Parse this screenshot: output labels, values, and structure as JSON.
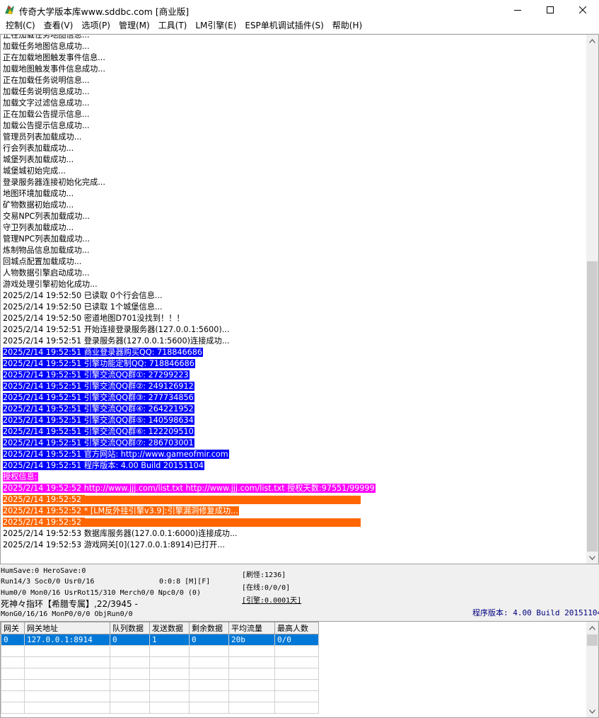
{
  "window": {
    "title": "传奇大学版本库www.sddbc.com [商业版]",
    "icon": "app-logo-icon",
    "controls": [
      "minimize-icon",
      "maximize-icon",
      "close-icon"
    ]
  },
  "menu": [
    "控制(C)",
    "查看(V)",
    "选项(P)",
    "管理(M)",
    "工具(T)",
    "LM引擎(E)",
    "ESP单机调试插件(S)",
    "帮助(H)"
  ],
  "log": {
    "lines": [
      {
        "text": "正在加载任务地图信息...",
        "style": "normal"
      },
      {
        "text": "加载任务地图信息成功...",
        "style": "normal"
      },
      {
        "text": "正在加载地图触发事件信息...",
        "style": "normal"
      },
      {
        "text": "加载地图触发事件信息成功...",
        "style": "normal"
      },
      {
        "text": "正在加载任务说明信息...",
        "style": "normal"
      },
      {
        "text": "加载任务说明信息成功...",
        "style": "normal"
      },
      {
        "text": "加载文字过滤信息成功...",
        "style": "normal"
      },
      {
        "text": "正在加载公告提示信息...",
        "style": "normal"
      },
      {
        "text": "加载公告提示信息成功...",
        "style": "normal"
      },
      {
        "text": "管理员列表加载成功...",
        "style": "normal"
      },
      {
        "text": "行会列表加载成功...",
        "style": "normal"
      },
      {
        "text": "城堡列表加载成功...",
        "style": "normal"
      },
      {
        "text": "城堡城初始完成...",
        "style": "normal"
      },
      {
        "text": "登录服务器连接初始化完成...",
        "style": "normal"
      },
      {
        "text": "地图环境加载成功...",
        "style": "normal"
      },
      {
        "text": "矿物数据初始成功...",
        "style": "normal"
      },
      {
        "text": "交易NPC列表加载成功...",
        "style": "normal"
      },
      {
        "text": "守卫列表加载成功...",
        "style": "normal"
      },
      {
        "text": "管理NPC列表加载成功...",
        "style": "normal"
      },
      {
        "text": "炼制物品信息加载成功...",
        "style": "normal"
      },
      {
        "text": "回城点配置加载成功...",
        "style": "normal"
      },
      {
        "text": "人物数据引擎启动成功...",
        "style": "normal"
      },
      {
        "text": "游戏处理引擎初始化成功...",
        "style": "normal"
      },
      {
        "text": "2025/2/14 19:52:50 已读取 0个行会信息...",
        "style": "normal"
      },
      {
        "text": "2025/2/14 19:52:50 已读取 1个城堡信息...",
        "style": "normal"
      },
      {
        "text": "2025/2/14 19:52:50 密道地图D701没找到！！！",
        "style": "normal"
      },
      {
        "text": "2025/2/14 19:52:51 开始连接登录服务器(127.0.0.1:5600)...",
        "style": "normal"
      },
      {
        "text": "2025/2/14 19:52:51 登录服务器(127.0.0.1:5600)连接成功...",
        "style": "normal"
      },
      {
        "text": "2025/2/14 19:52:51 商业登录器购买QQ: 718846686",
        "style": "blue"
      },
      {
        "text": "2025/2/14 19:52:51 引擎功能定制QQ: 718846686",
        "style": "blue"
      },
      {
        "text": "2025/2/14 19:52:51 引擎交流QQ群①: 27299223",
        "style": "blue"
      },
      {
        "text": "2025/2/14 19:52:51 引擎交流QQ群②: 249126912",
        "style": "blue"
      },
      {
        "text": "2025/2/14 19:52:51 引擎交流QQ群③: 277734856",
        "style": "blue"
      },
      {
        "text": "2025/2/14 19:52:51 引擎交流QQ群④: 264221952",
        "style": "blue"
      },
      {
        "text": "2025/2/14 19:52:51 引擎交流QQ群⑤: 140598634",
        "style": "blue"
      },
      {
        "text": "2025/2/14 19:52:51 引擎交流QQ群⑥: 122209510",
        "style": "blue"
      },
      {
        "text": "2025/2/14 19:52:51 引擎交流QQ群⑦: 286703001",
        "style": "blue"
      },
      {
        "text": "2025/2/14 19:52:51 官方网站: http://www.gameofmir.com",
        "style": "blue"
      },
      {
        "text": "2025/2/14 19:52:51 程序版本: 4.00 Build 20151104",
        "style": "blue"
      },
      {
        "text": "授权信息:",
        "style": "magenta"
      },
      {
        "text": "2025/2/14 19:52:52 http://www.jjj.com/list.txt http://www.jjj.com/list.txt 授权天数:97551/99999",
        "style": "magenta"
      },
      {
        "text": "2025/2/14 19:52:52 ",
        "style": "orange-bar"
      },
      {
        "text": "2025/2/14 19:52:52 * [LM反外挂引擎v3.9]:引擎漏洞修复成功...",
        "style": "orange"
      },
      {
        "text": "2025/2/14 19:52:52 ",
        "style": "orange-bar"
      },
      {
        "text": "2025/2/14 19:52:53 数据库服务器(127.0.0.1:6000)连接成功...",
        "style": "normal"
      },
      {
        "text": "2025/2/14 19:52:53 游戏网关[0](127.0.0.1:8914)已打开...",
        "style": "normal"
      }
    ],
    "scroll_position": 0.42
  },
  "status": {
    "line1": "HumSave:0 HeroSave:0",
    "line2a": "Run14/3 Soc0/0 Usr0/16",
    "line2b": "0:0:8 [M][F]",
    "line3": "Hum0/0 Mon0/16 UsrRot15/310 Merch0/0 Npc0/0 (0)",
    "line4": "死神々指环【希腊专属】,22/3945 -",
    "line5": "MonG0/16/16 MonP0/0/0 ObjRun0/0",
    "refresh": "[刷怪:1236]",
    "online": "[在线:0/0/0]",
    "engine": "[引擎:0.0001天]",
    "version": "程序版本: 4.00 Build 20151104"
  },
  "gate_table": {
    "columns": [
      "网关",
      "网关地址",
      "队列数据",
      "发送数据",
      "剩余数据",
      "平均流量",
      "最高人数"
    ],
    "rows": [
      [
        "0",
        "127.0.0.1:8914",
        "0",
        "1",
        "0",
        "20b",
        "0/0"
      ]
    ],
    "empty_rows": 6
  }
}
